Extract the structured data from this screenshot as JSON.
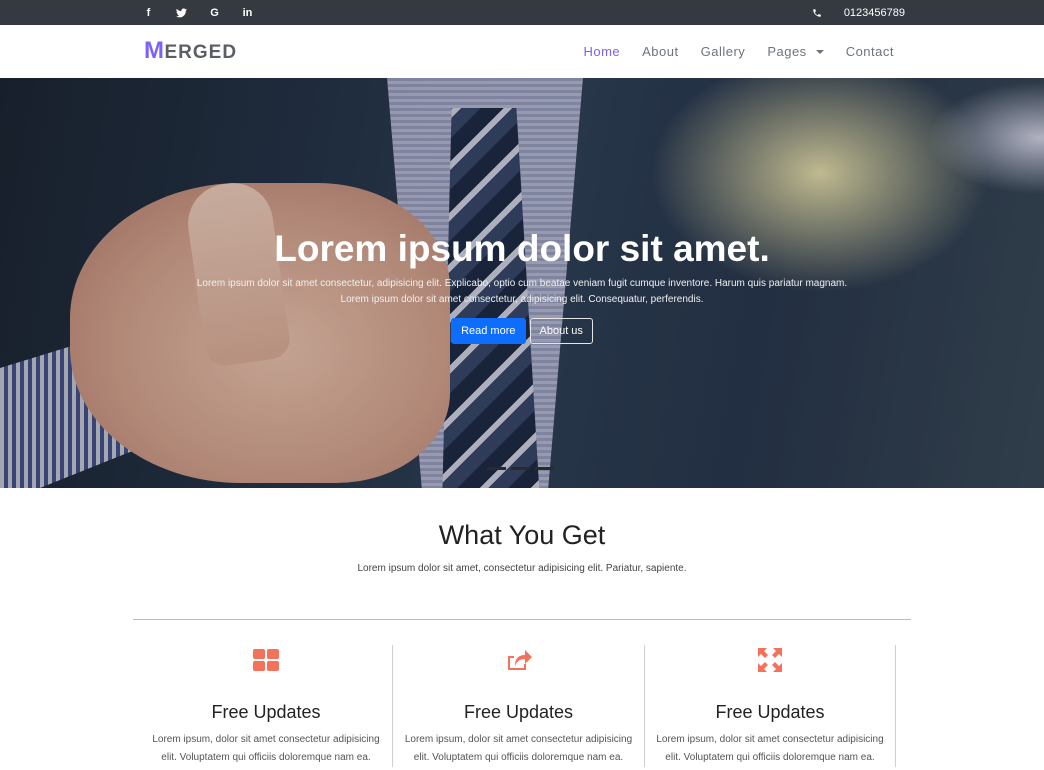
{
  "topbar": {
    "social": [
      {
        "icon": "facebook-icon",
        "glyph": "f"
      },
      {
        "icon": "twitter-icon",
        "glyph": "t"
      },
      {
        "icon": "google-icon",
        "glyph": "G"
      },
      {
        "icon": "linkedin-icon",
        "glyph": "in"
      }
    ],
    "phone": "0123456789"
  },
  "navbar": {
    "brand_initial": "M",
    "brand_rest": "ERGED",
    "links": [
      "Home",
      "About",
      "Gallery",
      "Pages",
      "Contact"
    ],
    "active": "Home"
  },
  "hero": {
    "title": "Lorem ipsum dolor sit amet.",
    "text_line1": "Lorem ipsum dolor sit amet consectetur, adipisicing elit. Explicabo, optio cum beatae veniam fugit cumque inventore. Harum quis pariatur magnam.",
    "text_line2": "Lorem ipsum dolor sit amet consectetur, adipisicing elit. Consequatur, perferendis.",
    "read_more": "Read more",
    "about_us": "About us"
  },
  "features": {
    "title": "What You Get",
    "subtitle": "Lorem ipsum dolor sit amet, consectetur adipisicing elit. Pariatur, sapiente.",
    "items": [
      {
        "icon": "grid-icon",
        "title": "Free Updates",
        "text": "Lorem ipsum, dolor sit amet consectetur adipisicing elit. Voluptatem qui officiis doloremque nam ea."
      },
      {
        "icon": "share-icon",
        "title": "Free Updates",
        "text": "Lorem ipsum, dolor sit amet consectetur adipisicing elit. Voluptatem qui officiis doloremque nam ea."
      },
      {
        "icon": "expand-arrows-icon",
        "title": "Free Updates",
        "text": "Lorem ipsum, dolor sit amet consectetur adipisicing elit. Voluptatem qui officiis doloremque nam ea."
      }
    ]
  },
  "colors": {
    "topbar_bg": "#343a40",
    "brand_accent": "#7b61ff",
    "primary_button": "#0d6efd",
    "feature_icon": "#f4715c"
  }
}
